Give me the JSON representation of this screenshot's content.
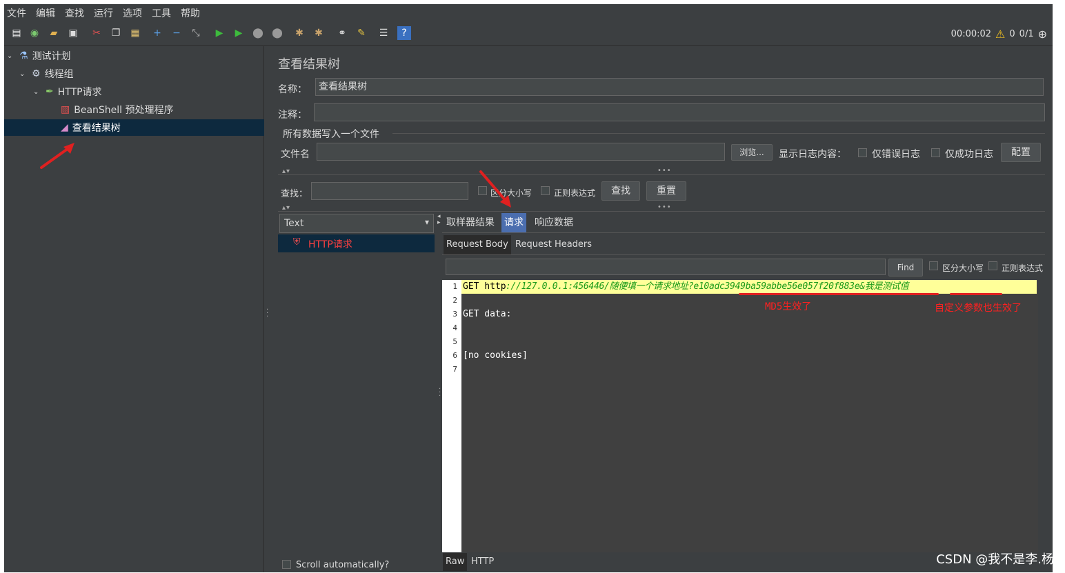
{
  "menu": [
    "文件",
    "编辑",
    "查找",
    "运行",
    "选项",
    "工具",
    "帮助"
  ],
  "toolbar_status": {
    "timer": "00:00:02",
    "warnings": "0",
    "threads": "0/1"
  },
  "tree": {
    "items": [
      {
        "label": "测试计划"
      },
      {
        "label": "线程组"
      },
      {
        "label": "HTTP请求"
      },
      {
        "label": "BeanShell 预处理程序"
      },
      {
        "label": "查看结果树"
      }
    ]
  },
  "main": {
    "title": "查看结果树",
    "name_label": "名称：",
    "name_value": "查看结果树",
    "comment_label": "注释：",
    "comment_value": "",
    "file_section": "所有数据写入一个文件",
    "filename_label": "文件名",
    "filename_value": "",
    "browse_button": "浏览...",
    "log_label": "显示日志内容：",
    "errors_only": "仅错误日志",
    "success_only": "仅成功日志",
    "config_button": "配置",
    "search_label": "查找：",
    "search_value": "",
    "case_sensitive": "区分大小写",
    "regex": "正则表达式",
    "find_button": "查找",
    "reset_button": "重置"
  },
  "results": {
    "renderer": "Text",
    "items": [
      {
        "label": "HTTP请求",
        "status": "error"
      }
    ],
    "scroll_auto": "Scroll automatically?"
  },
  "detail": {
    "tabs": [
      "取样器结果",
      "请求",
      "响应数据"
    ],
    "active_tab": "请求",
    "subtabs": [
      "Request Body",
      "Request Headers"
    ],
    "find_value": "",
    "find_button": "Find",
    "case_sensitive": "区分大小写",
    "regex": "正则表达式",
    "lines": [
      {
        "num": "1",
        "text": ""
      },
      {
        "num": "2",
        "text": ""
      },
      {
        "num": "3",
        "text": "GET data:"
      },
      {
        "num": "4",
        "text": ""
      },
      {
        "num": "5",
        "text": ""
      },
      {
        "num": "6",
        "text": "[no cookies]"
      },
      {
        "num": "7",
        "text": ""
      }
    ],
    "line1": {
      "method": "GET http",
      "url": "://127.0.0.1:456446/随便填一个请求地址?",
      "md5": "e10adc3949ba59abbe56e057f20f883e",
      "amp": "&",
      "custom": "我是测试值"
    },
    "annotation_md5": "MD5生效了",
    "annotation_custom": "自定义参数也生效了",
    "bottom_tabs": [
      "Raw",
      "HTTP"
    ]
  },
  "watermark": "CSDN @我不是李.杨",
  "colors": {
    "accent_red": "#e02020",
    "selection": "#0d293e",
    "line_highlight": "#ffff99"
  }
}
